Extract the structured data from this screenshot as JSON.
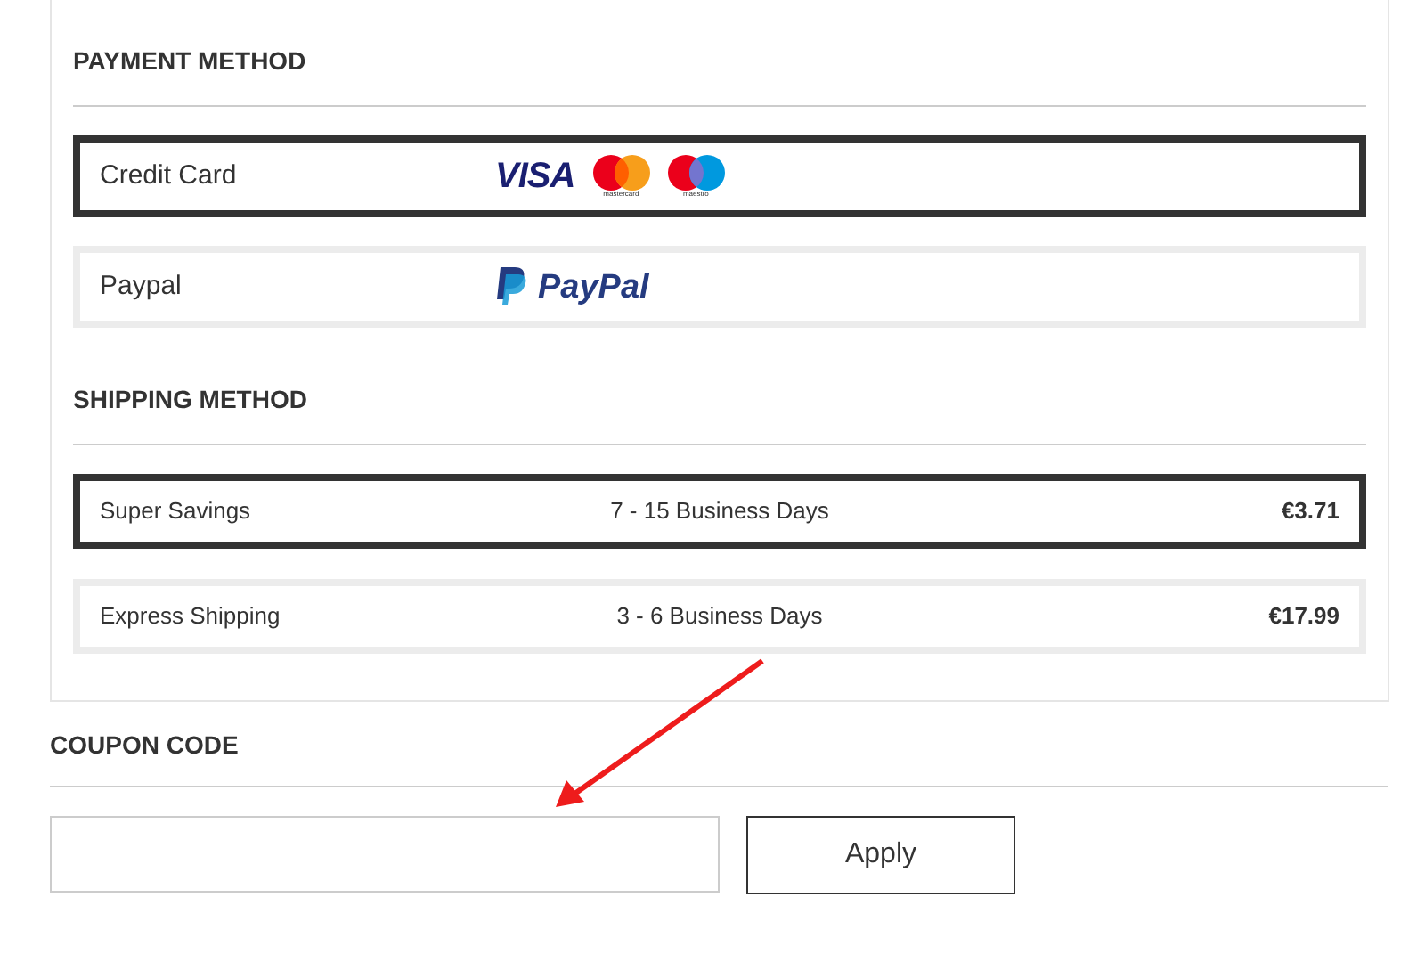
{
  "payment": {
    "heading": "PAYMENT METHOD",
    "methods": [
      {
        "label": "Credit Card",
        "selected": true,
        "logos": [
          {
            "kind": "visa",
            "text": "VISA"
          },
          {
            "kind": "mastercard",
            "text": "mastercard"
          },
          {
            "kind": "maestro",
            "text": "maestro"
          }
        ]
      },
      {
        "label": "Paypal",
        "selected": false,
        "logos": [
          {
            "kind": "paypal",
            "text": "PayPal"
          }
        ]
      }
    ]
  },
  "shipping": {
    "heading": "SHIPPING METHOD",
    "methods": [
      {
        "name": "Super Savings",
        "time": "7 - 15 Business Days",
        "price": "€3.71",
        "selected": true
      },
      {
        "name": "Express Shipping",
        "time": "3 - 6 Business Days",
        "price": "€17.99",
        "selected": false
      }
    ]
  },
  "coupon": {
    "heading": "COUPON CODE",
    "button": "Apply"
  }
}
